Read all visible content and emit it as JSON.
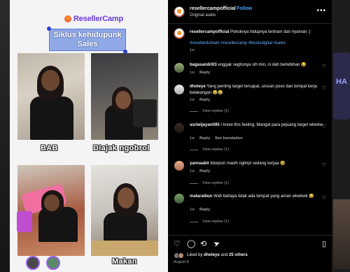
{
  "media": {
    "brand": "ResellerCamp",
    "headline_line1": "Siklus kehidupunk",
    "headline_line2": "Sales",
    "captions": [
      "BAB",
      "Diajak ngobrol",
      "Makan"
    ]
  },
  "post": {
    "username": "resellercampofficial",
    "follow_label": "Follow",
    "audio": "Original audio",
    "more_icon": "more-horizontal-icon",
    "caption_user": "resellercampofficial",
    "caption_text": "Pokoknya hidupnya tentram dan nyaman :)",
    "hashtags": "#resellerdomain #resellercamp #bisnisdigital #sales",
    "caption_age": "1w"
  },
  "comments": [
    {
      "user": "bagasandri03",
      "text": "enggak segitunya sih min, ni dah berlebihan 😂",
      "age": "1w",
      "reply": "Reply",
      "replies": "",
      "see_translation": ""
    },
    {
      "user": "dheteye",
      "text": "Yang penting target tercapai, urusan pose dan tempat kerja belakangan 😂😂",
      "age": "1w",
      "reply": "Reply",
      "replies": "View replies (1)",
      "see_translation": ""
    },
    {
      "user": "asriwijayanti95",
      "text": "I know this feeling. Mangat para pejuang target wkwkw",
      "age": "1w",
      "reply": "Reply",
      "replies": "View replies (1)",
      "see_translation": "See translation"
    },
    {
      "user": "yannaabii",
      "text": "tidurpun masih ngimpi sedang kerjaa 🤣",
      "age": "1w",
      "reply": "Reply",
      "replies": "View replies (1)",
      "see_translation": ""
    },
    {
      "user": "mataraibun",
      "text": "Wah bahaya tidak ada tempat yang aman wkwkwk 😂",
      "age": "1w",
      "reply": "Reply",
      "replies": "View replies (1)",
      "see_translation": ""
    }
  ],
  "actions": {
    "icons": [
      "heart-icon",
      "comment-icon",
      "repost-icon",
      "share-icon",
      "bookmark-icon"
    ],
    "liked_by_prefix": "Liked by",
    "liked_by_user": "dheteye",
    "liked_by_and": "and",
    "liked_by_others": "25 others",
    "date": "August 8"
  },
  "background_right": {
    "partial_text": "HA"
  }
}
